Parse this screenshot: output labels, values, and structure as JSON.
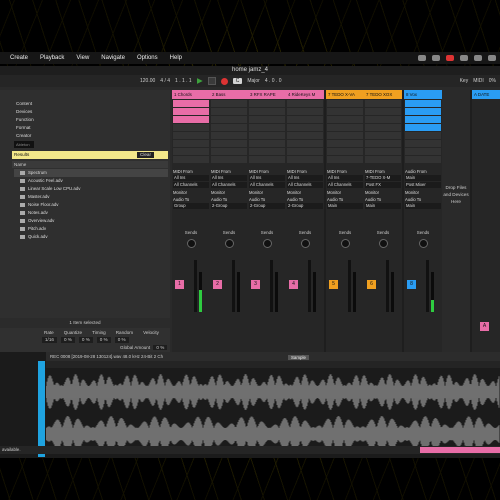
{
  "menubar": {
    "items": [
      "Create",
      "Playback",
      "View",
      "Navigate",
      "Options",
      "Help"
    ]
  },
  "window": {
    "title": "home jamz_4"
  },
  "transport": {
    "tempo": "120.00",
    "sig": "4 / 4",
    "bars": "1 . 1 . 1",
    "key": "C",
    "scale": "Major",
    "bars2": "4 . 0 . 0",
    "cpu": "0%",
    "key_label": "Key",
    "midi_label": "MIDI"
  },
  "browser": {
    "tree": [
      "Content",
      "Devices",
      "Function",
      "Format",
      "Creator",
      "Ableton"
    ],
    "search_placeholder": "Ableton",
    "results": "Results",
    "clear": "Clear",
    "name_header": "Name",
    "files": [
      "Spectrum",
      "Acoustic Feel.adv",
      "Linear Scale Low CPU.adv",
      "Master.adv",
      "Noise Floor.adv",
      "Notes.adv",
      "Overview.adv",
      "Pitch.adv",
      "Quick.adv"
    ],
    "tags": "Tags",
    "tag_value": "Utility",
    "item_selected": "1 Item selected"
  },
  "clip": {
    "headers": [
      "Rate",
      "Quantize",
      "Timing",
      "Random",
      "Velocity"
    ],
    "values": [
      "1/16",
      "0 %",
      "0 %",
      "0 %",
      "0 %"
    ],
    "global": "Global Amount",
    "global_val": "0 %"
  },
  "tracks": [
    {
      "name": "1 Chords",
      "color": "#e86da7",
      "num": "1",
      "from": "MIDI From",
      "src": "All Ins",
      "ch": "All Channels",
      "mon": "Monitor",
      "to": "Audio To",
      "dest": "Group",
      "sends": "Sends",
      "level": 0.55
    },
    {
      "name": "2 Bass",
      "color": "#e86da7",
      "num": "2",
      "from": "MIDI From",
      "src": "All Ins",
      "ch": "All Channels",
      "mon": "Monitor",
      "to": "Audio To",
      "dest": "2-Group",
      "sends": "Sends",
      "level": 0
    },
    {
      "name": "3 RFX RAPE",
      "color": "#e86da7",
      "num": "3",
      "from": "MIDI From",
      "src": "All Ins",
      "ch": "All Channels",
      "mon": "Monitor",
      "to": "Audio To",
      "dest": "2-Group",
      "sends": "Sends",
      "level": 0
    },
    {
      "name": "4 RideKeys M",
      "color": "#e86da7",
      "num": "4",
      "from": "MIDI From",
      "src": "All Ins",
      "ch": "All Channels",
      "mon": "Monitor",
      "to": "Audio To",
      "dest": "2-Group",
      "sends": "Sends",
      "level": 0
    },
    {
      "name": "7 TEDO X-VA",
      "color": "#f0a020",
      "num": "5",
      "from": "MIDI From",
      "src": "All Ins",
      "ch": "All Channels",
      "mon": "Monitor",
      "to": "Audio To",
      "dest": "Main",
      "sends": "Sends",
      "level": 0
    },
    {
      "name": "7 TEDO XOX",
      "color": "#f0a020",
      "num": "6",
      "from": "MIDI From",
      "src": "7-TEDO X-M",
      "ch": "Post FX",
      "mon": "Monitor",
      "to": "Audio To",
      "dest": "Main",
      "sends": "Sends",
      "level": 0
    },
    {
      "name": "8 Vox",
      "color": "#2a9df4",
      "num": "8",
      "from": "Audio From",
      "src": "Main",
      "ch": "Post Mixer",
      "mon": "Monitor",
      "to": "Audio To",
      "dest": "Main",
      "sends": "Sends",
      "level": 0.3
    }
  ],
  "dropzone": {
    "text": "Drop Files and Devices Here"
  },
  "master": {
    "name": "A DATE",
    "color": "#2a9df4",
    "num": "A"
  },
  "detail": {
    "clip_title": "REC 0008 [2019-08-28 130124].wav  48.0 kHz  24-Bit  2 Ch",
    "sample_tab": "Sample"
  },
  "status": {
    "text": "available."
  }
}
